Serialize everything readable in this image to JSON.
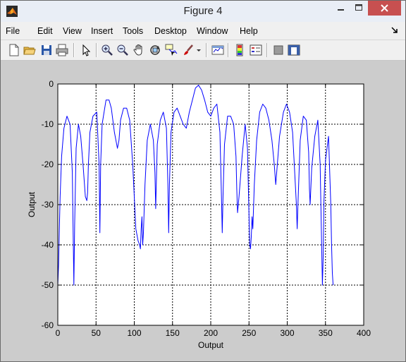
{
  "window": {
    "title": "Figure 4"
  },
  "menu": [
    "File",
    "Edit",
    "View",
    "Insert",
    "Tools",
    "Desktop",
    "Window",
    "Help"
  ],
  "toolbar": {
    "icons": [
      "new-figure-icon",
      "open-file-icon",
      "save-icon",
      "print-icon",
      "edit-plot-arrow-icon",
      "zoom-in-icon",
      "zoom-out-icon",
      "pan-hand-icon",
      "rotate-3d-icon",
      "data-cursor-icon",
      "brush-icon",
      "link-plot-icon",
      "colorbar-icon",
      "legend-icon",
      "hide-plot-tools-icon",
      "show-plot-tools-icon"
    ]
  },
  "chart_data": {
    "type": "line",
    "title": "",
    "xlabel": "Output",
    "ylabel": "Output",
    "xlim": [
      0,
      400
    ],
    "ylim": [
      -60,
      0
    ],
    "xticks": [
      0,
      50,
      100,
      150,
      200,
      250,
      300,
      350,
      400
    ],
    "yticks": [
      0,
      -10,
      -20,
      -30,
      -40,
      -50,
      -60
    ],
    "grid": true,
    "line_color": "#0000ff",
    "series": [
      {
        "x": [
          0,
          1,
          2,
          3,
          5,
          8,
          12,
          16,
          19,
          21,
          22,
          24,
          27,
          30,
          33,
          36,
          38,
          39,
          40,
          42,
          46,
          51,
          54,
          55,
          56,
          58,
          63,
          67,
          70,
          74,
          78,
          80,
          82,
          86,
          90,
          94,
          98,
          102,
          105,
          107,
          108,
          109,
          110,
          111,
          112,
          114,
          117,
          121,
          125,
          127,
          128,
          130,
          134,
          138,
          142,
          144,
          145,
          146,
          148,
          152,
          156,
          160,
          164,
          168,
          172,
          176,
          180,
          184,
          188,
          192,
          196,
          200,
          204,
          208,
          212,
          214,
          215,
          216,
          218,
          222,
          226,
          230,
          233,
          234,
          235,
          237,
          241,
          245,
          248,
          250,
          251,
          252,
          253,
          254,
          255,
          257,
          260,
          264,
          268,
          272,
          276,
          280,
          283,
          285,
          290,
          295,
          299,
          303,
          307,
          310,
          312,
          313,
          314,
          317,
          321,
          325,
          328,
          329,
          330,
          332,
          336,
          340,
          343,
          345,
          346,
          347,
          348,
          350,
          354,
          357,
          358,
          359,
          360
        ],
        "values": [
          -50,
          -45,
          -36,
          -28,
          -18,
          -11,
          -8,
          -10,
          -22,
          -50,
          -35,
          -16,
          -10,
          -13,
          -20,
          -28,
          -29,
          -27,
          -20,
          -12,
          -8,
          -7,
          -20,
          -37,
          -20,
          -10,
          -4,
          -4,
          -6,
          -12,
          -16,
          -14,
          -9,
          -6,
          -6,
          -9,
          -20,
          -36,
          -39,
          -40,
          -41,
          -36,
          -33,
          -40,
          -37,
          -25,
          -14,
          -10,
          -14,
          -22,
          -31,
          -15,
          -9,
          -7,
          -11,
          -25,
          -37,
          -25,
          -12,
          -7,
          -6,
          -8,
          -10,
          -11,
          -7,
          -4,
          -1,
          -0.3,
          -1.5,
          -4,
          -7,
          -8,
          -6,
          -5,
          -12,
          -28,
          -37,
          -28,
          -15,
          -8,
          -8,
          -10,
          -18,
          -26,
          -32,
          -28,
          -18,
          -10,
          -16,
          -33,
          -40,
          -41,
          -38,
          -33,
          -36,
          -25,
          -14,
          -7,
          -5,
          -6,
          -9,
          -14,
          -20,
          -25,
          -13,
          -7,
          -5,
          -7,
          -12,
          -23,
          -30,
          -36,
          -30,
          -14,
          -8,
          -9,
          -17,
          -26,
          -30,
          -21,
          -13,
          -9,
          -20,
          -40,
          -50,
          -43,
          -29,
          -19,
          -13,
          -30,
          -40,
          -47,
          -50
        ]
      }
    ]
  }
}
